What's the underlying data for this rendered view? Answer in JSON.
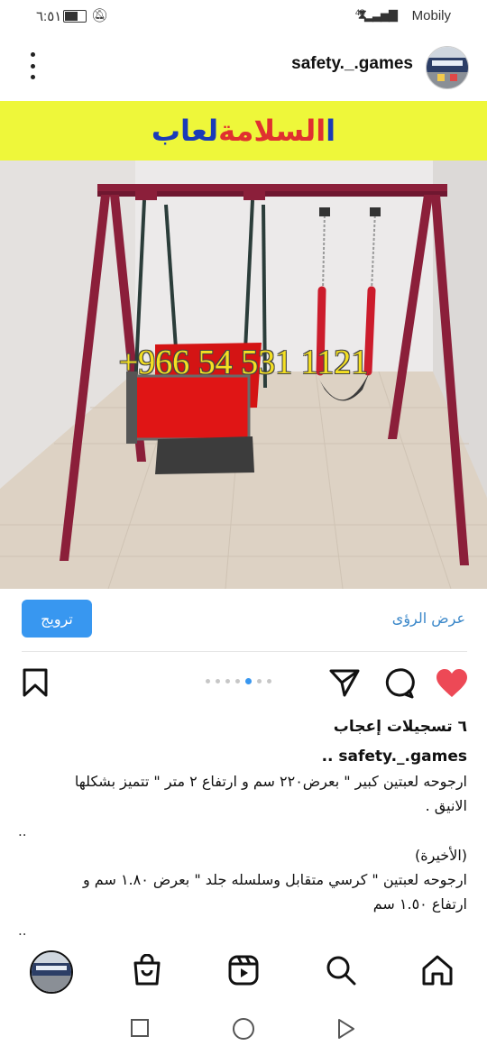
{
  "status_bar": {
    "time": "٦:٥١",
    "carrier": "Mobily",
    "network": "4G"
  },
  "post": {
    "username": "safety._.games",
    "banner_text_part1": "السلامة",
    "banner_text_part2": "لعاب",
    "banner_text_part0": "ا",
    "phone_overlay": "+966 54 531 1121",
    "promote_label": "ترويج",
    "insights_label": "عرض الرؤى",
    "carousel_count": 6,
    "carousel_active_index": 6,
    "likes": "٦ تسجيلات إعجاب",
    "caption_username": "safety._.games ..",
    "caption_line1": "ارجوحه لعبتين كبير \" بعرض٢٢٠ سم و ارتفاع ٢ متر \" تتميز بشكلها",
    "caption_line2": "الانيق .",
    "caption_sep1": "..",
    "caption_line3": "(الأخيرة)",
    "caption_line4": "ارجوحه لعبتين \" كرسي متقابل وسلسله جلد \"  بعرض ١.٨٠ سم و",
    "caption_line5": "ارتفاع ١.٥٠ سم",
    "caption_sep2": ".."
  },
  "bottom_nav": {
    "items": [
      "home-icon",
      "search-icon",
      "reels-icon",
      "shop-icon",
      "profile-avatar"
    ]
  },
  "colors": {
    "accent": "#3897f0",
    "like": "#ed4956",
    "banner_bg": "#eef73a",
    "frame": "#8b1f3a",
    "seat": "#e01515"
  }
}
